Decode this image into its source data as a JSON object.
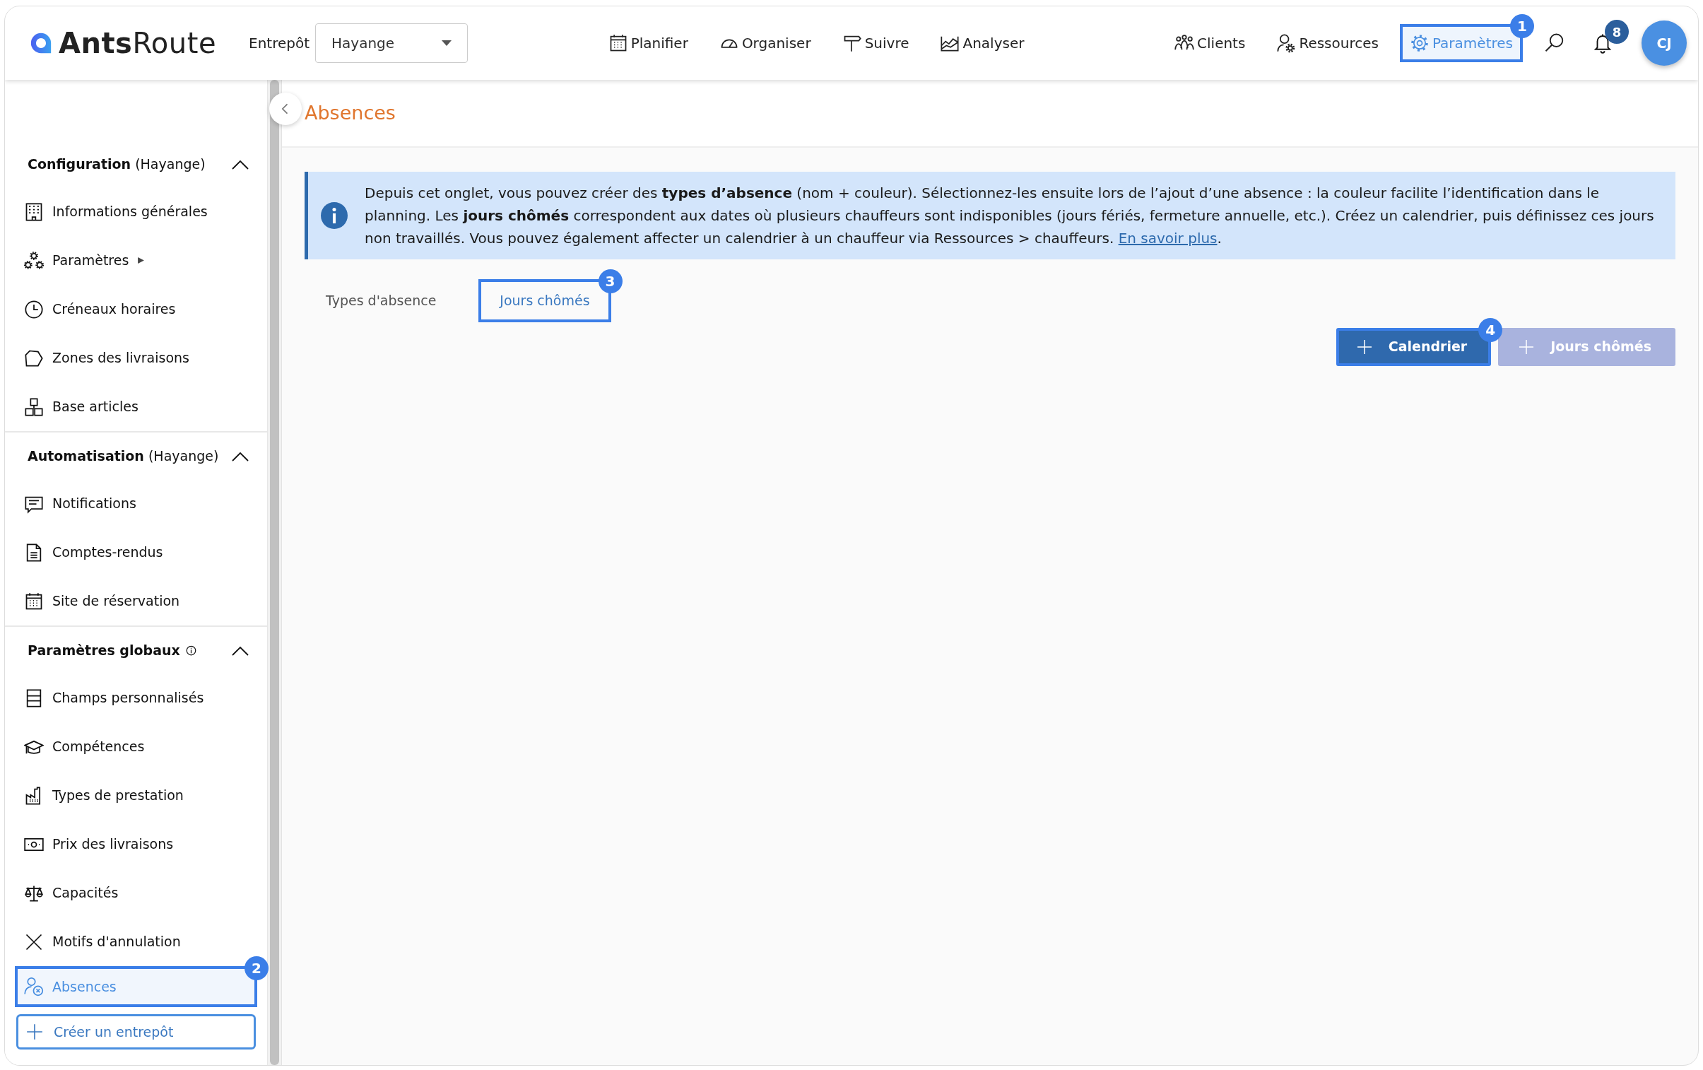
{
  "logo": {
    "bold": "Ants",
    "light": "Route"
  },
  "warehouse": {
    "label": "Entrepôt",
    "value": "Hayange"
  },
  "nav_center": [
    {
      "label": "Planifier",
      "selected": false
    },
    {
      "label": "Organiser",
      "selected": false
    },
    {
      "label": "Suivre",
      "selected": false
    },
    {
      "label": "Analyser",
      "selected": false
    }
  ],
  "nav_right": [
    {
      "label": "Clients",
      "selected": false
    },
    {
      "label": "Ressources",
      "selected": false
    },
    {
      "label": "Paramètres",
      "selected": true,
      "callout": "1"
    }
  ],
  "notifications": {
    "count": "8"
  },
  "avatar": {
    "initials": "CJ"
  },
  "sidebar": {
    "sections": [
      {
        "title": "Configuration",
        "subtitle": "(Hayange)",
        "expanded": true,
        "items": [
          {
            "label": "Informations générales",
            "selected": false
          },
          {
            "label": "Paramètres",
            "selected": false,
            "submenu": true
          },
          {
            "label": "Créneaux horaires",
            "selected": false
          },
          {
            "label": "Zones des livraisons",
            "selected": false
          },
          {
            "label": "Base articles",
            "selected": false
          }
        ]
      },
      {
        "title": "Automatisation",
        "subtitle": "(Hayange)",
        "expanded": true,
        "items": [
          {
            "label": "Notifications",
            "selected": false
          },
          {
            "label": "Comptes-rendus",
            "selected": false
          },
          {
            "label": "Site de réservation",
            "selected": false
          }
        ]
      },
      {
        "title": "Paramètres globaux",
        "info": true,
        "expanded": true,
        "items": [
          {
            "label": "Champs personnalisés",
            "selected": false
          },
          {
            "label": "Compétences",
            "selected": false
          },
          {
            "label": "Types de prestation",
            "selected": false
          },
          {
            "label": "Prix des livraisons",
            "selected": false
          },
          {
            "label": "Capacités",
            "selected": false
          },
          {
            "label": "Motifs d'annulation",
            "selected": false
          },
          {
            "label": "Absences",
            "selected": true,
            "callout": "2"
          }
        ]
      }
    ],
    "create_button": {
      "label": "Créer un entrepôt"
    }
  },
  "page_title": "Absences",
  "info": {
    "text": "Depuis cet onglet, vous pouvez créer des **types d’absence** (nom + couleur). Sélectionnez-les ensuite lors de l’ajout d’une absence : la couleur facilite l’identification dans le planning. Les **jours chômés** correspondent aux dates où plusieurs chauffeurs sont indisponibles (jours fériés, fermeture annuelle, etc.). Créez un calendrier, puis définissez ces jours non travaillés. Vous pouvez également affecter un calendrier à un chauffeur via Ressources > chauffeurs.",
    "link": "En savoir plus",
    "after": "."
  },
  "tabs": [
    {
      "label": "Types d'absence",
      "selected": false
    },
    {
      "label": "Jours chômés",
      "selected": true,
      "callout": "3"
    }
  ],
  "buttons": [
    {
      "label": "Calendrier",
      "disabled": false,
      "callout": "4"
    },
    {
      "label": "Jours chômés",
      "disabled": true
    }
  ]
}
